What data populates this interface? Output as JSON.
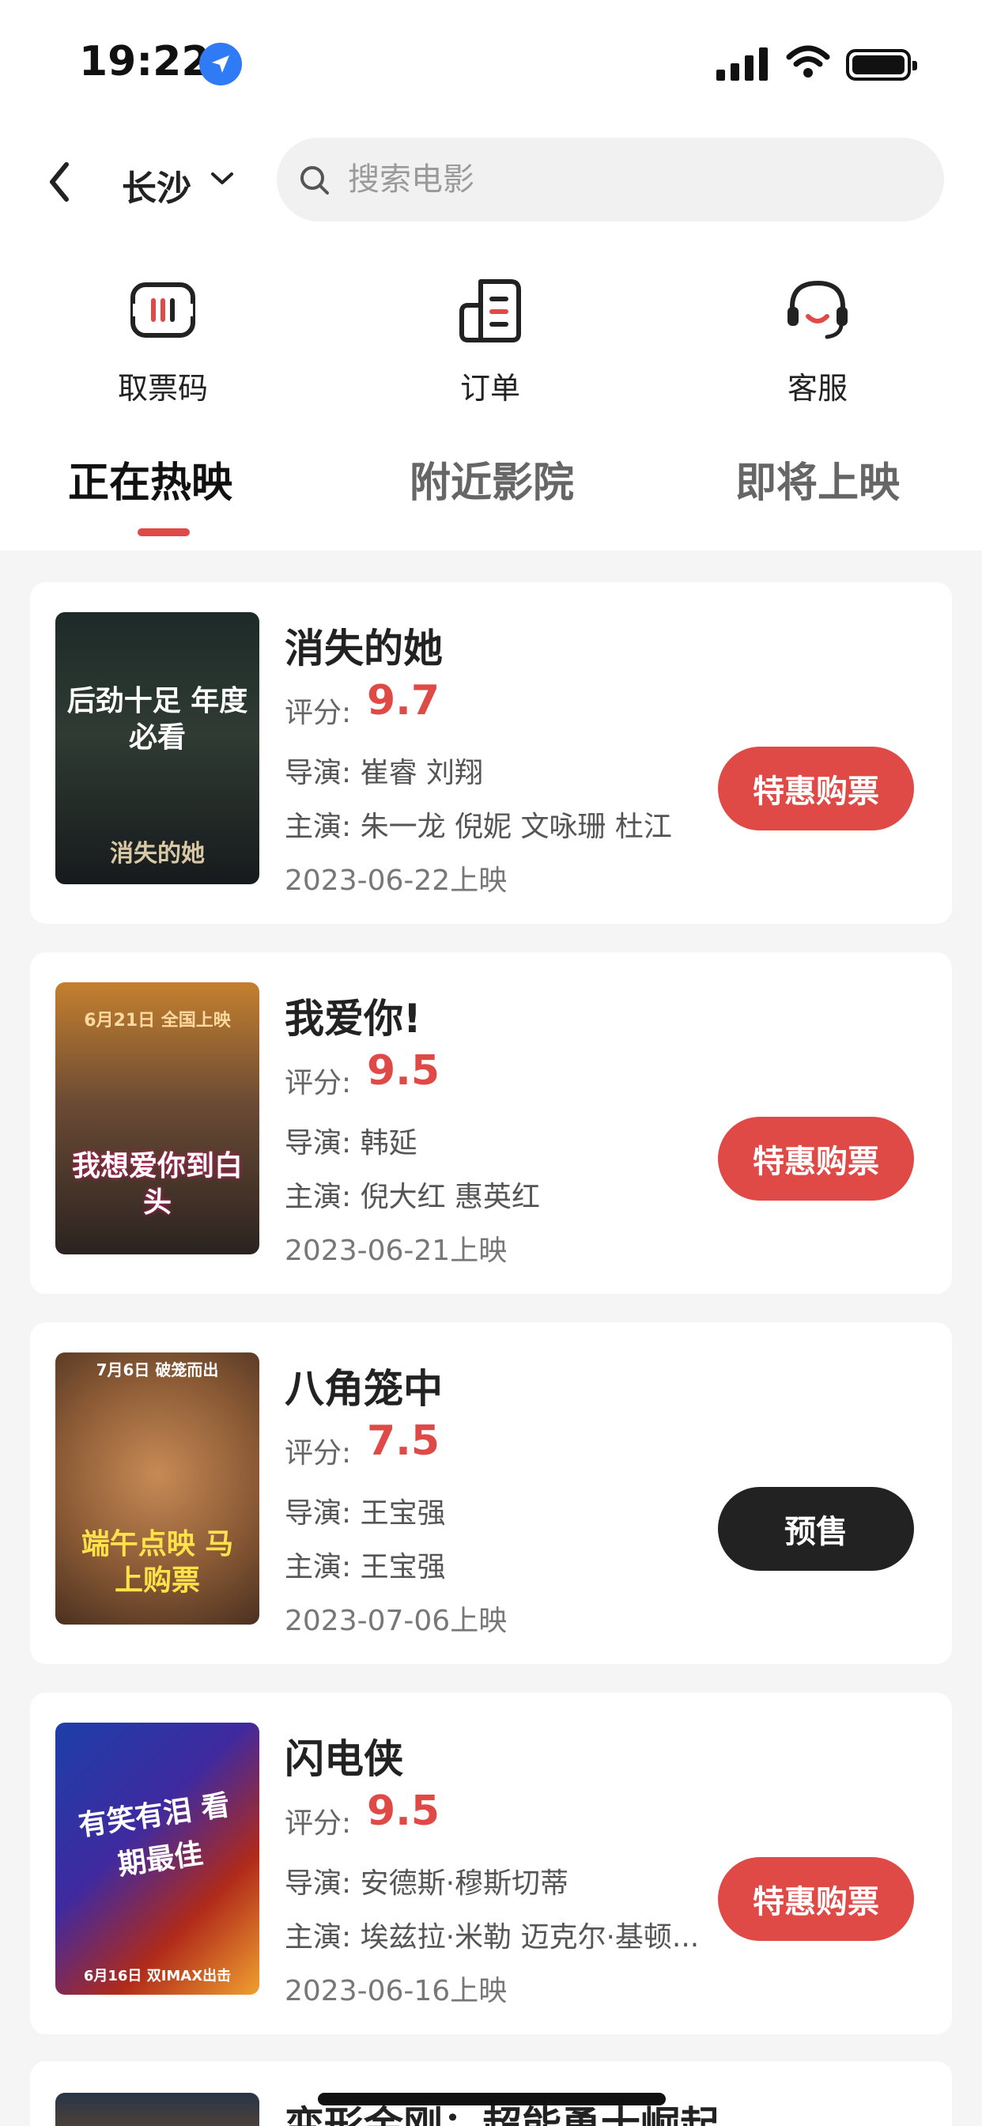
{
  "status_bar": {
    "time": "19:22"
  },
  "header": {
    "city": "长沙",
    "search_placeholder": "搜索电影"
  },
  "quick_actions": [
    {
      "label": "取票码",
      "icon": "ticket-code-icon"
    },
    {
      "label": "订单",
      "icon": "order-icon"
    },
    {
      "label": "客服",
      "icon": "headset-icon"
    }
  ],
  "tabs": [
    {
      "label": "正在热映",
      "active": true
    },
    {
      "label": "附近影院",
      "active": false
    },
    {
      "label": "即将上映",
      "active": false
    }
  ],
  "labels": {
    "score": "评分:",
    "director": "导演:",
    "cast": "主演:"
  },
  "movies": [
    {
      "title": "消失的她",
      "score": "9.7",
      "director": "崔睿 刘翔",
      "cast": "朱一龙 倪妮 文咏珊 杜江",
      "date": "2023-06-22上映",
      "button": "特惠购票",
      "poster_text": "后劲十足 年度必看",
      "poster_subtext": "消失的她"
    },
    {
      "title": "我爱你!",
      "score": "9.5",
      "director": "韩延",
      "cast": "倪大红 惠英红",
      "date": "2023-06-21上映",
      "button": "特惠购票",
      "poster_text": "我想爱你到白头",
      "poster_subtext": "6月21日 全国上映"
    },
    {
      "title": "八角笼中",
      "score": "7.5",
      "director": "王宝强",
      "cast": "王宝强",
      "date": "2023-07-06上映",
      "button": "预售",
      "poster_text": "端午点映 马上购票",
      "poster_subtext": "7月6日 破笼而出"
    },
    {
      "title": "闪电侠",
      "score": "9.5",
      "director": "安德斯·穆斯切蒂",
      "cast": "埃兹拉·米勒 迈克尔·基顿...",
      "date": "2023-06-16上映",
      "button": "特惠购票",
      "poster_text": "有笑有泪 看期最佳",
      "poster_subtext": "6月16日 双IMAX出击"
    },
    {
      "title": "变形金刚：超能勇士崛起"
    }
  ],
  "colors": {
    "accent": "#e04a46",
    "dark_button": "#222222"
  }
}
